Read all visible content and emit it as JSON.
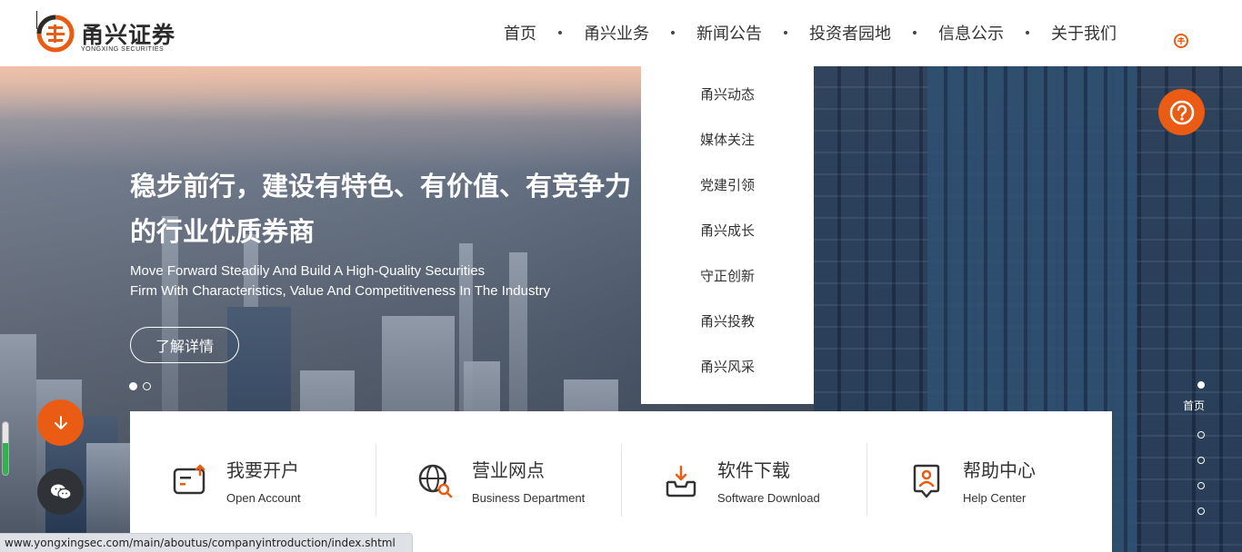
{
  "header": {
    "logo_cn": "甬兴证券",
    "logo_en": "YONGXING SECURITIES",
    "nav": [
      "首页",
      "甬兴业务",
      "新闻公告",
      "投资者园地",
      "信息公示",
      "关于我们"
    ]
  },
  "hero": {
    "title": "稳步前行，建设有特色、有价值、有竞争力的行业优质券商",
    "subtitle_line1": "Move Forward Steadily And Build A High-Quality Securities",
    "subtitle_line2": "Firm With Characteristics, Value And Competitiveness In The Industry",
    "button": "了解详情",
    "slide_count": 2,
    "active_slide": 1
  },
  "dropdown": {
    "items": [
      "甬兴动态",
      "媒体关注",
      "党建引领",
      "甬兴成长",
      "守正创新",
      "甬兴投教",
      "甬兴风采"
    ]
  },
  "side_pager": {
    "active_label": "首页",
    "count": 5
  },
  "services": [
    {
      "title": "我要开户",
      "subtitle": "Open Account",
      "icon": "open-account-icon"
    },
    {
      "title": "营业网点",
      "subtitle": "Business Department",
      "icon": "globe-search-icon"
    },
    {
      "title": "软件下载",
      "subtitle": "Software Download",
      "icon": "download-tray-icon"
    },
    {
      "title": "帮助中心",
      "subtitle": "Help Center",
      "icon": "help-center-icon"
    }
  ],
  "colors": {
    "accent": "#ea5b13",
    "dark_button": "#2f3338",
    "status_bar": "#dee1e6"
  },
  "status_url": "www.yongxingsec.com/main/aboutus/companyintroduction/index.shtml",
  "scroll_fill": 0.6
}
